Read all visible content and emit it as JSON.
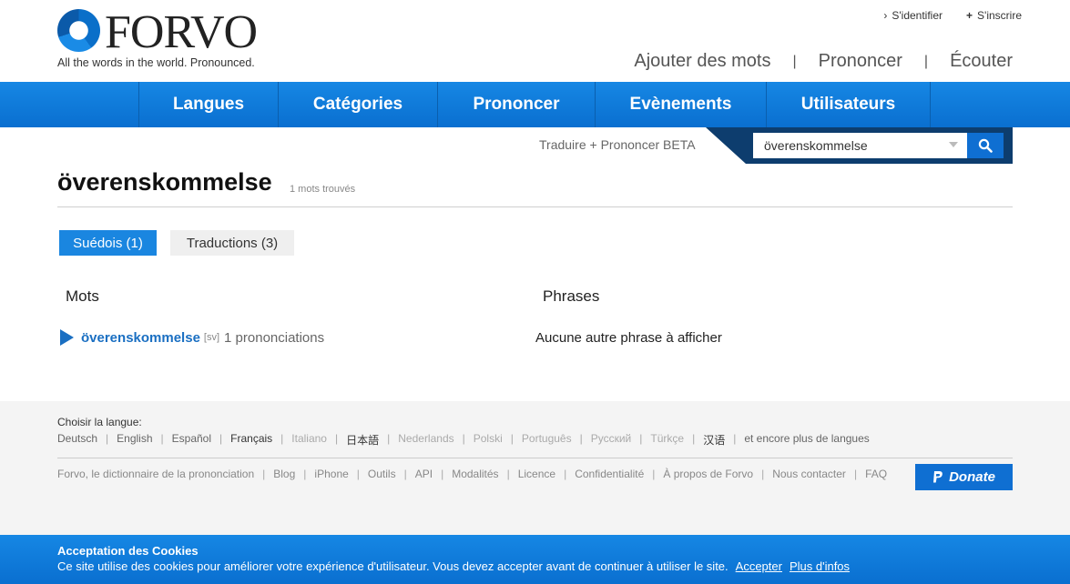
{
  "header": {
    "logo_text": "FORVO",
    "tagline": "All the words in the world. Pronounced.",
    "top_links": [
      {
        "label": "S'identifier",
        "icon": "chevron-right-icon"
      },
      {
        "label": "S'inscrire",
        "icon": "plus-icon"
      }
    ],
    "main_links": [
      "Ajouter des mots",
      "Prononcer",
      "Écouter"
    ],
    "separator": "|"
  },
  "nav": {
    "items": [
      "Langues",
      "Catégories",
      "Prononcer",
      "Evènements",
      "Utilisateurs"
    ]
  },
  "search": {
    "translate_link": "Traduire + Prononcer BETA",
    "value": "överenskommelse"
  },
  "word": {
    "title": "överenskommelse",
    "count": "1 mots trouvés"
  },
  "tabs": [
    {
      "label": "Suédois (1)",
      "active": true
    },
    {
      "label": "Traductions (3)",
      "active": false
    }
  ],
  "columns": {
    "words_header": "Mots",
    "phrases_header": "Phrases",
    "word_entry": {
      "word": "överenskommelse",
      "lang_code": "[sv]",
      "pronunciations": "1 prononciations"
    },
    "no_phrases": "Aucune autre phrase à afficher"
  },
  "footer": {
    "lang_label": "Choisir la langue:",
    "languages": [
      "Deutsch",
      "English",
      "Español",
      "Français",
      "Italiano",
      "日本語",
      "Nederlands",
      "Polski",
      "Português",
      "Русский",
      "Türkçe",
      "汉语",
      "et encore plus de langues"
    ],
    "links": [
      "Forvo, le dictionnaire de la prononciation",
      "Blog",
      "iPhone",
      "Outils",
      "API",
      "Modalités",
      "Licence",
      "Confidentialité",
      "À propos de Forvo",
      "Nous contacter",
      "FAQ"
    ],
    "donate_label": "Donate"
  },
  "cookie": {
    "title": "Acceptation des Cookies",
    "text": "Ce site utilise des cookies pour améliorer votre expérience d'utilisateur. Vous devez accepter avant de continuer à utiliser le site.",
    "accept": "Accepter",
    "more": "Plus d'infos"
  },
  "colors": {
    "brand_blue": "#0f6fd2",
    "link_blue": "#1a6fc2",
    "search_dark": "#0d3d6e"
  }
}
